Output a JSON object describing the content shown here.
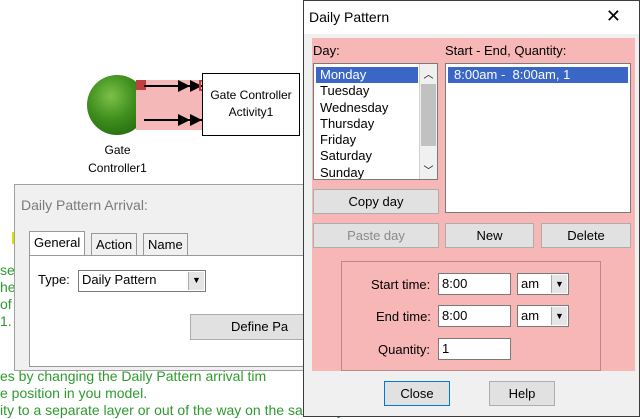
{
  "canvas": {
    "gate_label": "Gate\nController1",
    "activity_label": "Gate Controller\nActivity1",
    "bg_text_lines": [
      "se",
      "he",
      "of",
      "1.",
      "es by changing the Daily Pattern arrival tim",
      "e position in you model.",
      "ity to a separate layer or out of the way on the same layer"
    ]
  },
  "bg_dialog": {
    "title": "Daily Pattern Arrival:",
    "tabs": [
      "General",
      "Action",
      "Name"
    ],
    "type_label": "Type:",
    "type_value": "Daily Pattern",
    "define_button": "Define Pa"
  },
  "dialog": {
    "title": "Daily Pattern",
    "day_label": "Day:",
    "days": [
      "Monday",
      "Tuesday",
      "Wednesday",
      "Thursday",
      "Friday",
      "Saturday",
      "Sunday"
    ],
    "selected_day": "Monday",
    "entries_label": "Start - End, Quantity:",
    "entries": [
      "8:00am -  8:00am, 1"
    ],
    "buttons": {
      "copy_day": "Copy day",
      "paste_day": "Paste day",
      "new": "New",
      "delete": "Delete",
      "close": "Close",
      "help": "Help"
    },
    "start_time_label": "Start time:",
    "start_time": "8:00",
    "start_ampm": "am",
    "end_time_label": "End time:",
    "end_time": "8:00",
    "end_ampm": "am",
    "quantity_label": "Quantity:",
    "quantity": "1"
  },
  "colors": {
    "dialog_pink": "#f7b7b7",
    "selection_blue": "#3a67c6",
    "green_text": "#2e9a2e"
  }
}
